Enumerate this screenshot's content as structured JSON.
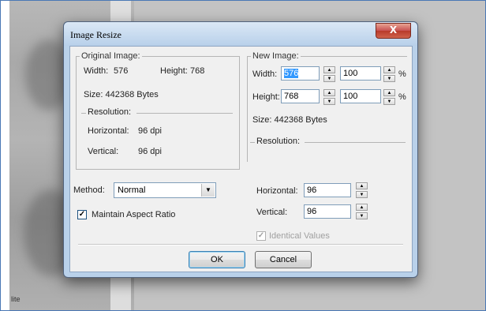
{
  "dialog": {
    "title": "Image Resize",
    "close_symbol": "X"
  },
  "original": {
    "legend": "Original Image:",
    "width_label": "Width:",
    "width_value": "576",
    "height_label": "Height:",
    "height_value": "768",
    "size_text": "Size:  442368 Bytes",
    "resolution_legend": "Resolution:",
    "horizontal_label": "Horizontal:",
    "horizontal_value": "96 dpi",
    "vertical_label": "Vertical:",
    "vertical_value": "96 dpi"
  },
  "method": {
    "label": "Method:",
    "selected": "Normal"
  },
  "maintain_aspect": {
    "label": "Maintain Aspect Ratio",
    "checked": true
  },
  "new_image": {
    "legend": "New Image:",
    "width_label": "Width:",
    "width_value": "576",
    "width_percent": "100",
    "height_label": "Height:",
    "height_value": "768",
    "height_percent": "100",
    "percent_symbol": "%",
    "size_text": "Size:  442368 Bytes",
    "resolution_legend": "Resolution:",
    "horizontal_label": "Horizontal:",
    "horizontal_value": "96",
    "vertical_label": "Vertical:",
    "vertical_value": "96",
    "identical_values_label": "Identical Values",
    "identical_values_checked": true,
    "identical_values_enabled": false
  },
  "buttons": {
    "ok": "OK",
    "cancel": "Cancel"
  },
  "background": {
    "status_text": "lite"
  },
  "colors": {
    "selection": "#3399ff",
    "close_button": "#c75050",
    "frame": "#b9d1ea"
  }
}
